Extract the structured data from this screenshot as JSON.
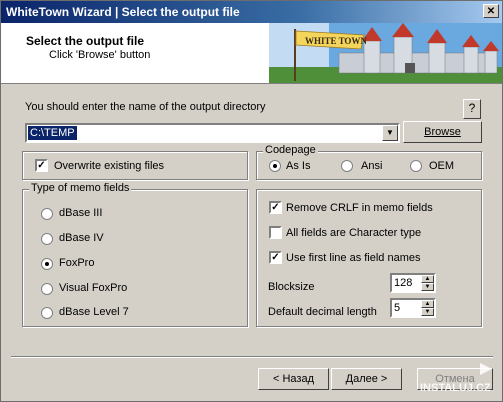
{
  "window": {
    "title": "WhiteTown Wizard | Select the output file"
  },
  "header": {
    "title": "Select the output file",
    "subtitle": "Click 'Browse' button",
    "banner_text": "WHITE TOWN"
  },
  "output": {
    "prompt": "You should enter the name of the output directory",
    "help_label": "?",
    "path": "C:\\TEMP",
    "browse_label": "Browse"
  },
  "overwrite": {
    "label": "Overwrite existing files",
    "checked": true
  },
  "codepage": {
    "title": "Codepage",
    "options": [
      "As Is",
      "Ansi",
      "OEM"
    ],
    "selected": "As Is"
  },
  "memo": {
    "title": "Type of memo fields",
    "options": [
      "dBase III",
      "dBase IV",
      "FoxPro",
      "Visual FoxPro",
      "dBase Level 7"
    ],
    "selected": "FoxPro"
  },
  "options": {
    "remove_crlf": {
      "label": "Remove CRLF in memo fields",
      "checked": true
    },
    "all_char": {
      "label": "All fields are Character type",
      "checked": false
    },
    "first_line": {
      "label": "Use first line as field names",
      "checked": true
    },
    "blocksize": {
      "label": "Blocksize",
      "value": "128"
    },
    "decimal": {
      "label": "Default decimal length",
      "value": "5"
    }
  },
  "buttons": {
    "back": "< Назад",
    "next": "Далее >",
    "cancel": "Отмена"
  },
  "watermark": "INSTALUJ.CZ"
}
